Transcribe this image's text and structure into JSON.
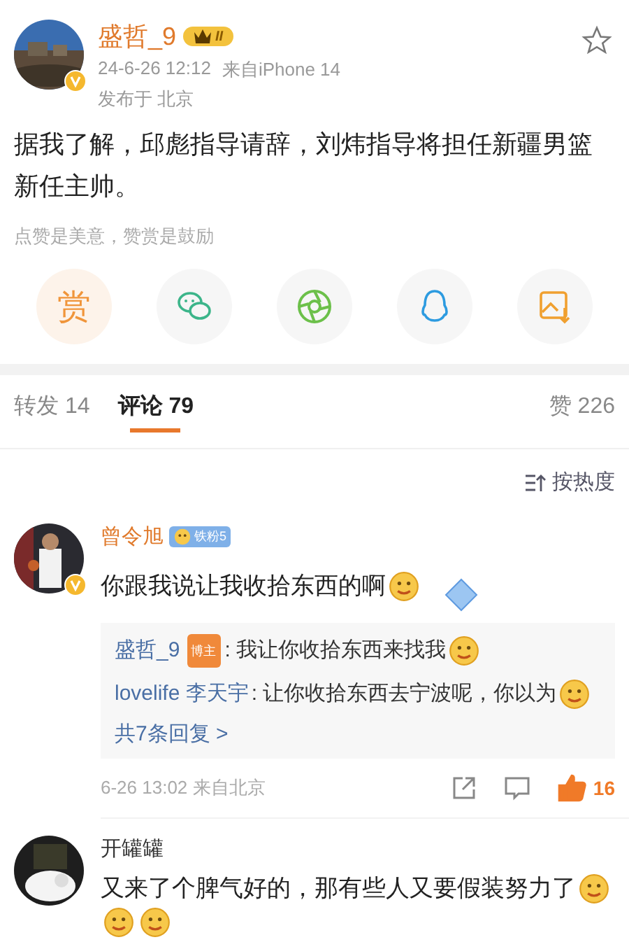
{
  "post": {
    "author": "盛哲_9",
    "level_badge": "II",
    "starred": false,
    "time": "24-6-26 12:12",
    "source": "来自iPhone 14",
    "location": "发布于 北京",
    "text": "据我了解，邱彪指导请辞，刘炜指导将担任新疆男篮新任主帅。",
    "reward_hint": "点赞是美意，赞赏是鼓励"
  },
  "share_actions": [
    {
      "kind": "reward",
      "label": "赏"
    },
    {
      "kind": "wechat"
    },
    {
      "kind": "moments"
    },
    {
      "kind": "qq"
    },
    {
      "kind": "save_image"
    }
  ],
  "tabs": [
    {
      "label": "转发 14",
      "selected": false
    },
    {
      "label": "评论 79",
      "selected": true
    },
    {
      "label": "赞 226",
      "selected": false
    }
  ],
  "sort": {
    "label": "按热度"
  },
  "comments": [
    {
      "author": "曾令旭",
      "verified": true,
      "badge": {
        "kind": "fan",
        "label": "铁粉5"
      },
      "content": [
        {
          "kind": "text",
          "text": "你跟我说让我收拾东西的啊"
        },
        {
          "kind": "emoji"
        },
        {
          "kind": "sticker"
        }
      ],
      "replies": [
        {
          "author": "盛哲_9",
          "badge": "博主",
          "content": [
            {
              "kind": "text",
              "text": ": 我让你收拾东西来找我"
            },
            {
              "kind": "emoji"
            }
          ]
        },
        {
          "author": "lovelife 李天宇",
          "content": [
            {
              "kind": "text",
              "text": ": 让你收拾东西去宁波呢，你以为"
            },
            {
              "kind": "emoji"
            }
          ]
        }
      ],
      "more_replies": "共7条回复 >",
      "meta": "6-26 13:02 来自北京",
      "likes": "16",
      "liked": true
    },
    {
      "author": "开罐罐",
      "verified": false,
      "content": [
        {
          "kind": "text",
          "text": "又来了个脾气好的，那有些人又要假装努力了"
        },
        {
          "kind": "emoji"
        },
        {
          "kind": "emoji"
        },
        {
          "kind": "emoji"
        }
      ]
    }
  ]
}
